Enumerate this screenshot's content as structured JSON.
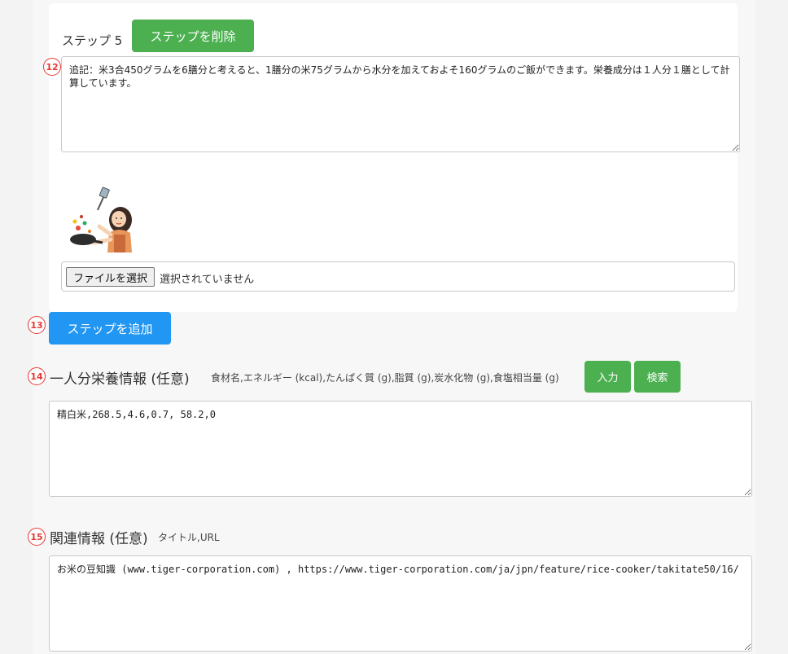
{
  "step": {
    "label": "ステップ 5",
    "delete_button": "ステップを削除",
    "marker": "12",
    "text": "追記：米3合450グラムを6膳分と考えると、1膳分の米75グラムから水分を加えておよそ160グラムのご飯ができます。栄養成分は１人分１膳として計算しています。",
    "file_button": "ファイルを選択",
    "file_status": "選択されていません"
  },
  "add_step": {
    "marker": "13",
    "button": "ステップを追加"
  },
  "nutrition": {
    "marker": "14",
    "title": "一人分栄養情報 (任意)",
    "hint": "食材名,エネルギー (kcal),たんぱく質 (g),脂質 (g),炭水化物 (g),食塩相当量 (g)",
    "input_button": "入力",
    "search_button": "検索",
    "value": "精白米,268.5,4.6,0.7, 58.2,0"
  },
  "related": {
    "marker": "15",
    "title": "関連情報 (任意)",
    "hint": "タイトル,URL",
    "value": "お米の豆知識 (www.tiger-corporation.com) , https://www.tiger-corporation.com/ja/jpn/feature/rice-cooker/takitate50/16/"
  },
  "colors": {
    "green_button": "#4caf50",
    "blue_button": "#2196f3",
    "marker_red": "#e53935"
  }
}
